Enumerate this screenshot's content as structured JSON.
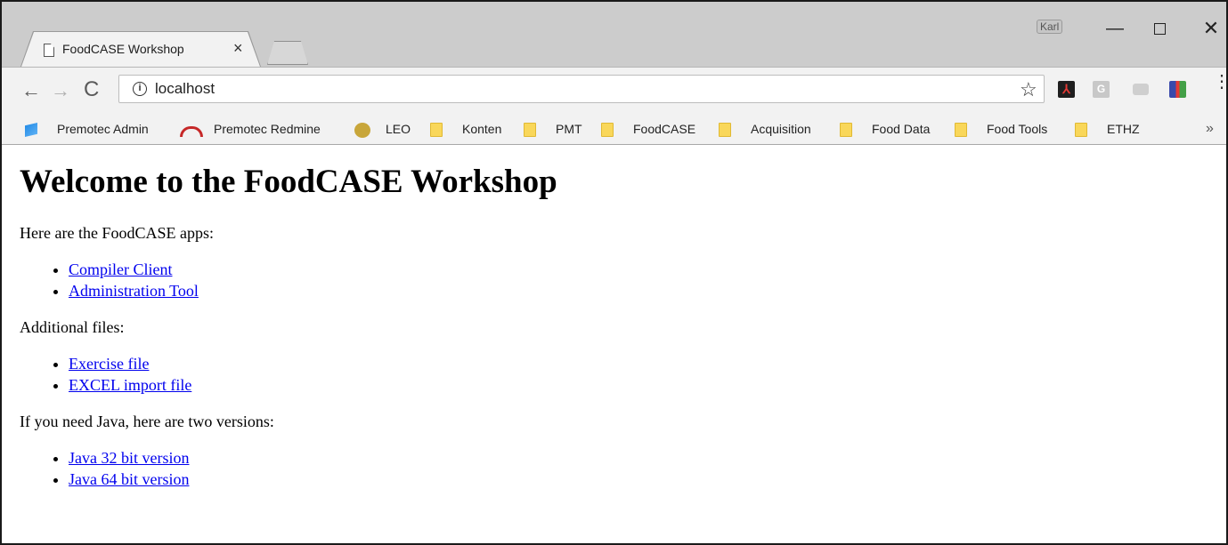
{
  "browser": {
    "tab": {
      "title": "FoodCASE Workshop",
      "close_glyph": "×"
    },
    "profile_name": "Karl",
    "window_controls": {
      "minimize": "—",
      "maximize": "",
      "close": "✕"
    },
    "nav": {
      "back": "←",
      "forward": "→",
      "reload": "C"
    },
    "address": {
      "info": "i",
      "url": "localhost"
    },
    "star": "☆",
    "extensions": [
      {
        "name": "pdf-extension-icon",
        "glyph": "⅄"
      },
      {
        "name": "g-extension-icon",
        "glyph": "G"
      }
    ],
    "menu": "⋮"
  },
  "bookmarks": [
    {
      "label": "Premotec Admin",
      "icon": "premotec-admin-icon"
    },
    {
      "label": "Premotec Redmine",
      "icon": "redmine-icon"
    },
    {
      "label": "LEO",
      "icon": "leo-icon"
    },
    {
      "label": "Konten",
      "icon": "folder-icon"
    },
    {
      "label": "PMT",
      "icon": "folder-icon"
    },
    {
      "label": "FoodCASE",
      "icon": "folder-icon"
    },
    {
      "label": "Acquisition",
      "icon": "folder-icon"
    },
    {
      "label": "Food Data",
      "icon": "folder-icon"
    },
    {
      "label": "Food Tools",
      "icon": "folder-icon"
    },
    {
      "label": "ETHZ",
      "icon": "folder-icon"
    }
  ],
  "bookmarks_overflow": "»",
  "page": {
    "heading": "Welcome to the FoodCASE Workshop",
    "apps_intro": "Here are the FoodCASE apps:",
    "apps": [
      "Compiler Client",
      "Administration Tool"
    ],
    "files_intro": "Additional files:",
    "files": [
      "Exercise file",
      "EXCEL import file"
    ],
    "java_intro": "If you need Java, here are two versions:",
    "java": [
      "Java 32 bit version",
      "Java 64 bit version"
    ]
  }
}
